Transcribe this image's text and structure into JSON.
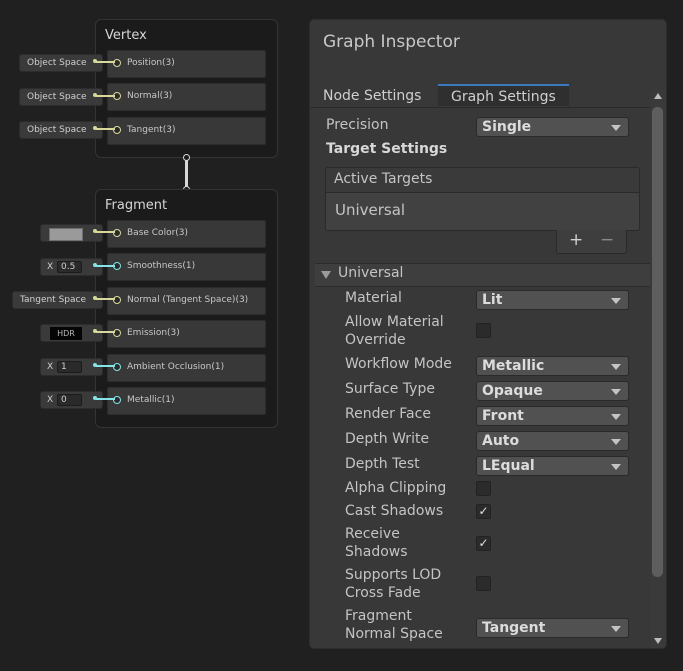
{
  "vertex": {
    "title": "Vertex",
    "ports": [
      {
        "label": "Position(3)",
        "input": "Object Space"
      },
      {
        "label": "Normal(3)",
        "input": "Object Space"
      },
      {
        "label": "Tangent(3)",
        "input": "Object Space"
      }
    ]
  },
  "fragment": {
    "title": "Fragment",
    "ports": [
      {
        "label": "Base Color(3)",
        "input": ""
      },
      {
        "label": "Smoothness(1)",
        "input_x": "X",
        "input_value": "0.5"
      },
      {
        "label": "Normal (Tangent Space)(3)",
        "input": "Tangent Space"
      },
      {
        "label": "Emission(3)",
        "input": "HDR"
      },
      {
        "label": "Ambient Occlusion(1)",
        "input_x": "X",
        "input_value": "1"
      },
      {
        "label": "Metallic(1)",
        "input_x": "X",
        "input_value": "0"
      }
    ]
  },
  "inspector": {
    "title": "Graph Inspector",
    "tabs": [
      "Node Settings",
      "Graph Settings"
    ],
    "active_tab": "Graph Settings",
    "precision_label": "Precision",
    "precision_value": "Single",
    "target_settings_label": "Target Settings",
    "active_targets_label": "Active Targets",
    "active_targets": [
      "Universal"
    ],
    "add_symbol": "+",
    "remove_symbol": "−",
    "section_title": "Universal",
    "properties": [
      {
        "label": "Material",
        "type": "dropdown",
        "value": "Lit"
      },
      {
        "label": "Allow Material Override",
        "type": "checkbox",
        "checked": false
      },
      {
        "label": "Workflow Mode",
        "type": "dropdown",
        "value": "Metallic"
      },
      {
        "label": "Surface Type",
        "type": "dropdown",
        "value": "Opaque"
      },
      {
        "label": "Render Face",
        "type": "dropdown",
        "value": "Front"
      },
      {
        "label": "Depth Write",
        "type": "dropdown",
        "value": "Auto"
      },
      {
        "label": "Depth Test",
        "type": "dropdown",
        "value": "LEqual"
      },
      {
        "label": "Alpha Clipping",
        "type": "checkbox",
        "checked": false
      },
      {
        "label": "Cast Shadows",
        "type": "checkbox",
        "checked": true
      },
      {
        "label": "Receive Shadows",
        "type": "checkbox",
        "checked": true
      },
      {
        "label": "Supports LOD Cross Fade",
        "type": "checkbox",
        "checked": false
      },
      {
        "label": "Fragment Normal Space",
        "type": "dropdown",
        "value": "Tangent"
      }
    ],
    "check_glyph": "✓"
  },
  "colors": {
    "vector3_port": "#d8d89a",
    "float_port": "#84e4e7",
    "tab_accent": "#3a79bb"
  }
}
